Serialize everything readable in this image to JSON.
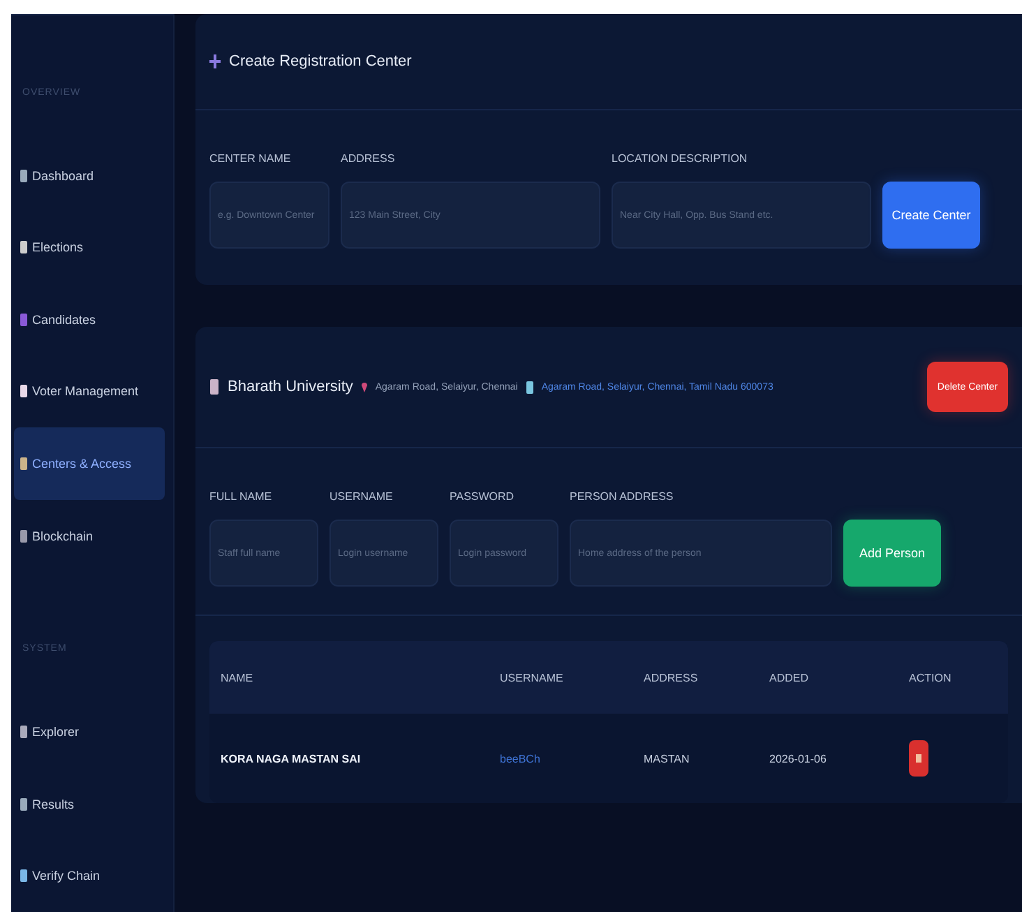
{
  "sidebar": {
    "sections": [
      {
        "title": "OVERVIEW",
        "items": [
          {
            "label": "Dashboard",
            "selected": false
          },
          {
            "label": "Elections",
            "selected": false
          },
          {
            "label": "Candidates",
            "selected": false
          },
          {
            "label": "Voter Management",
            "selected": false
          },
          {
            "label": "Centers & Access",
            "selected": true
          },
          {
            "label": "Blockchain",
            "selected": false
          }
        ]
      },
      {
        "title": "SYSTEM",
        "items": [
          {
            "label": "Explorer",
            "selected": false
          },
          {
            "label": "Results",
            "selected": false
          },
          {
            "label": "Verify Chain",
            "selected": false
          }
        ]
      }
    ]
  },
  "create_card": {
    "title": "Create Registration Center",
    "fields": [
      {
        "label": "CENTER NAME",
        "placeholder": "e.g. Downtown Center"
      },
      {
        "label": "ADDRESS",
        "placeholder": "123 Main Street, City"
      },
      {
        "label": "LOCATION DESCRIPTION",
        "placeholder": "Near City Hall, Opp. Bus Stand etc."
      }
    ],
    "button": "Create Center"
  },
  "center": {
    "name": "Bharath University",
    "location": "Agaram Road, Selaiyur, Chennai",
    "address": "Agaram Road, Selaiyur, Chennai, Tamil Nadu 600073",
    "delete_button": "Delete Center",
    "fields": [
      {
        "label": "FULL NAME",
        "placeholder": "Staff full name"
      },
      {
        "label": "USERNAME",
        "placeholder": "Login username"
      },
      {
        "label": "PASSWORD",
        "placeholder": "Login password"
      },
      {
        "label": "PERSON ADDRESS",
        "placeholder": "Home address of the person"
      }
    ],
    "add_button": "Add Person",
    "table": {
      "columns": [
        "NAME",
        "USERNAME",
        "ADDRESS",
        "ADDED",
        "ACTION"
      ],
      "rows": [
        {
          "name": "KORA NAGA MASTAN SAI",
          "username": "beeBCh",
          "address": "MASTAN",
          "added": "2026-01-06"
        }
      ]
    }
  }
}
